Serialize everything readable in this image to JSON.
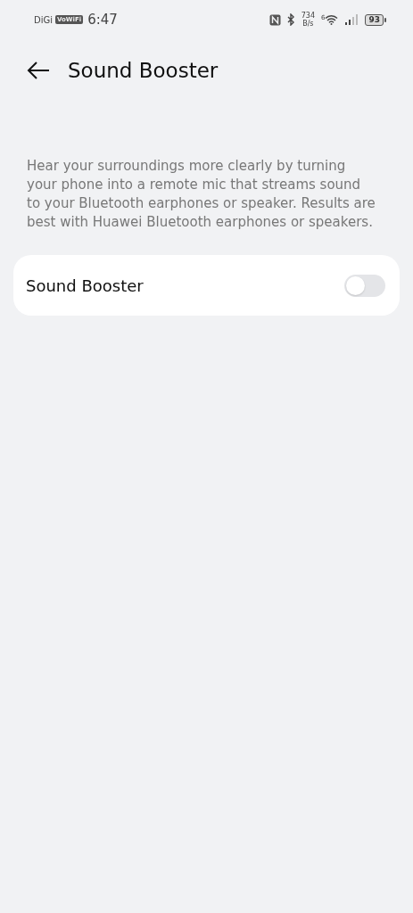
{
  "status_bar": {
    "carrier": "DiGi",
    "vowifi_badge": "VoWiFi",
    "time": "6:47",
    "net_speed_value": "734",
    "net_speed_unit": "B/s",
    "wifi_badge": "6",
    "battery": "93"
  },
  "header": {
    "title": "Sound Booster"
  },
  "description": "Hear your surroundings more clearly by turning your phone into a remote mic that streams sound to your Bluetooth earphones or speaker. Results are best with Huawei Bluetooth earphones or speakers.",
  "settings": [
    {
      "label": "Sound Booster",
      "on": false
    }
  ]
}
